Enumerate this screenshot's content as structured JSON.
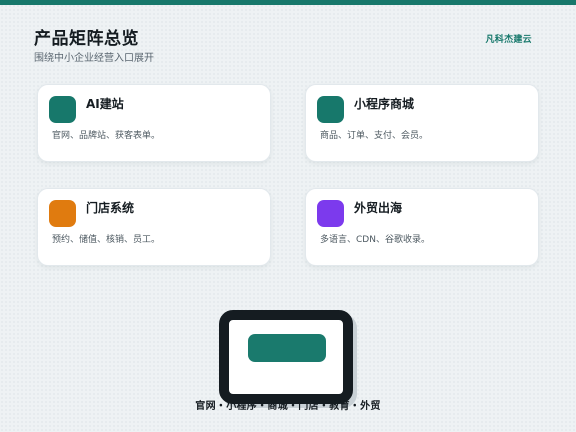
{
  "header": {
    "title": "产品矩阵总览",
    "subtitle": "围绕中小企业经营入口展开",
    "brand": "凡科杰建云"
  },
  "cards": [
    {
      "title": "AI建站",
      "desc": "官网、品牌站、获客表单。",
      "icon": "teal-square-icon",
      "icon_color": "#17786b"
    },
    {
      "title": "小程序商城",
      "desc": "商品、订单、支付、会员。",
      "icon": "teal-square-icon",
      "icon_color": "#17786b"
    },
    {
      "title": "门店系统",
      "desc": "预约、储值、核销、员工。",
      "icon": "orange-square-icon",
      "icon_color": "#e07b0f"
    },
    {
      "title": "外贸出海",
      "desc": "多语言、CDN、谷歌收录。",
      "icon": "purple-square-icon",
      "icon_color": "#7c3aed"
    }
  ],
  "footer": {
    "caption": "官网・小程序・商城・门店・教育・外贸"
  },
  "colors": {
    "accent": "#17786b",
    "orange": "#e07b0f",
    "purple": "#7c3aed",
    "dark": "#151c21"
  }
}
